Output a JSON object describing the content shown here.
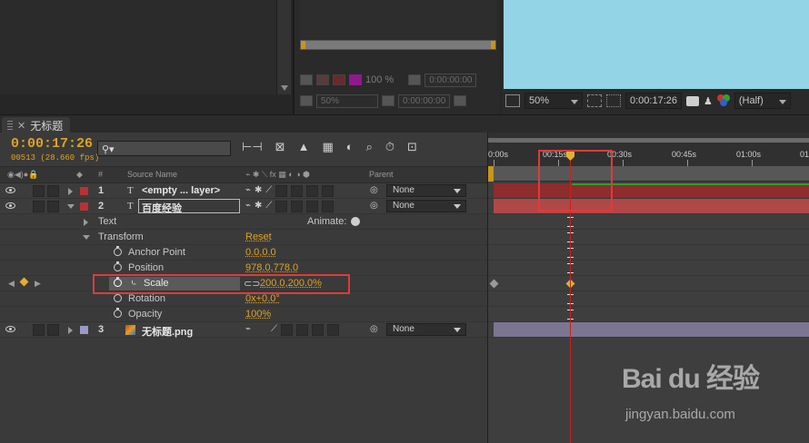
{
  "timeline": {
    "tab_title": "无标题",
    "timecode": "0:00:17:26",
    "frame_info": "00513 (28.660 fps)",
    "search_placeholder": "",
    "columns": {
      "hash": "#",
      "source_name": "Source Name",
      "parent": "Parent"
    },
    "layers": [
      {
        "num": "1",
        "type_glyph": "T",
        "name": "<empty ... layer>",
        "label_color": "#b83232",
        "parent": "None"
      },
      {
        "num": "2",
        "type_glyph": "T",
        "name": "百度经验",
        "label_color": "#b83232",
        "parent": "None"
      },
      {
        "num": "3",
        "type_glyph": "",
        "name": "无标题.png",
        "label_color": "#9a9ac8",
        "parent": "None"
      }
    ],
    "text_group": {
      "label": "Text",
      "animate_label": "Animate:"
    },
    "transform": {
      "label": "Transform",
      "reset": "Reset"
    },
    "properties": [
      {
        "name": "Anchor Point",
        "value": "0.0,0.0"
      },
      {
        "name": "Position",
        "value": "978.0,778.0"
      },
      {
        "name": "Scale",
        "value": "200.0,200.0%"
      },
      {
        "name": "Rotation",
        "value": "0x+0.0°"
      },
      {
        "name": "Opacity",
        "value": "100%"
      }
    ],
    "ruler_labels": [
      "0:00s",
      "00:15s",
      "00:30s",
      "00:45s",
      "01:00s",
      "01:"
    ]
  },
  "mid_panel": {
    "percent": "100 %",
    "zoom": "50%",
    "timecode1": "0:00:00:00",
    "timecode2": "0:00:00:00"
  },
  "comp_bar": {
    "zoom": "50%",
    "timecode": "0:00:17:26",
    "resolution": "(Half)"
  },
  "watermark": {
    "logo": "Bai du 经验",
    "url": "jingyan.baidu.com"
  },
  "colors": {
    "accent_orange": "#e0a320",
    "sky": "#93d5e6",
    "layer1_bar": "#8d2d2d",
    "layer2_bar": "#b04848",
    "layer3_bar": "#7c7590",
    "highlight": "#e03a3a"
  }
}
